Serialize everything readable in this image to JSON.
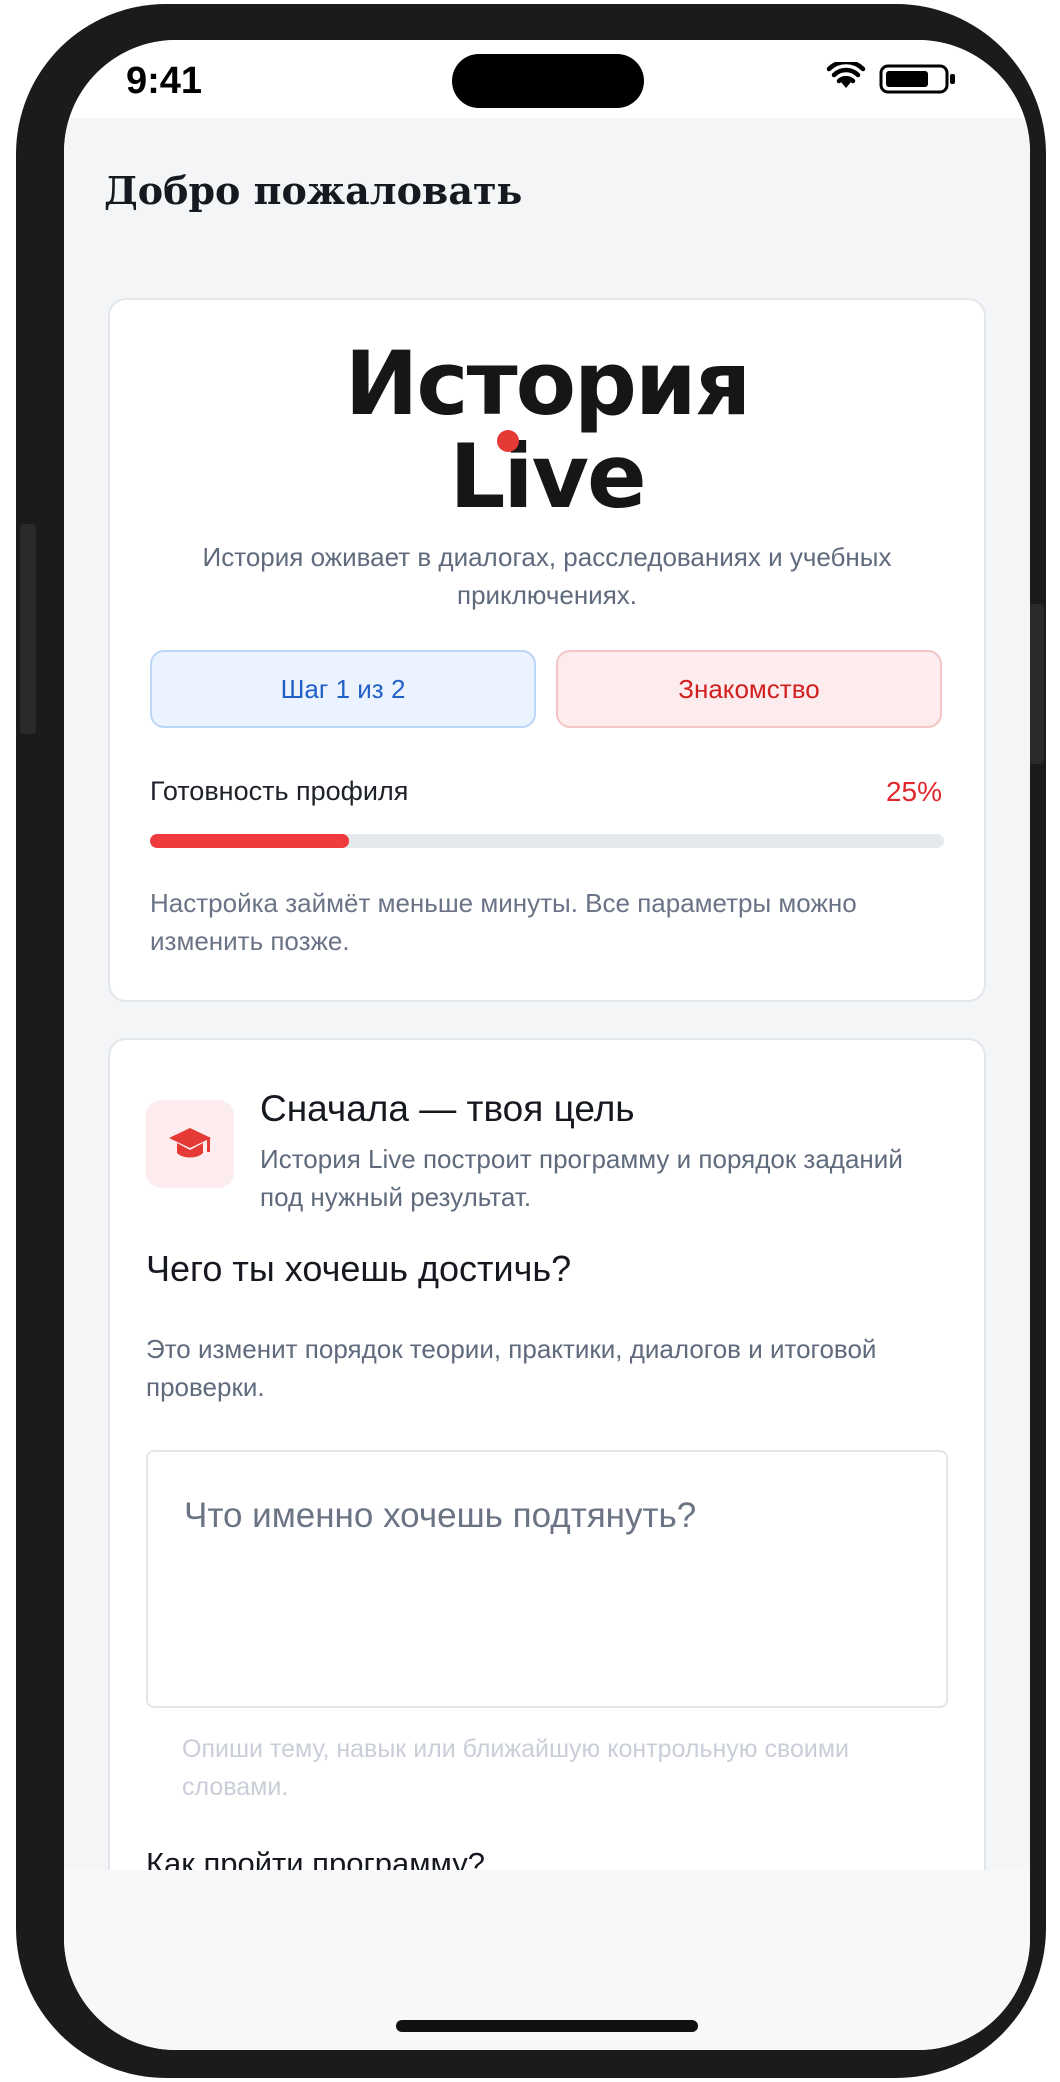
{
  "status_bar": {
    "time": "9:41",
    "wifi_icon": "wifi-icon",
    "battery_icon": "battery-icon"
  },
  "header": {
    "title": "Добро пожаловать"
  },
  "hero": {
    "logo_line1": "История",
    "logo_line2": "Live",
    "logo_accent_color": "#e53935",
    "tagline": "История оживает в диалогах, расследованиях и учебных приключениях.",
    "step_label": "Шаг 1 из 2",
    "stage_label": "Знакомство",
    "progress_label": "Готовность профиля",
    "progress_text": "25%",
    "progress_value": 0.25,
    "hint": "Настройка займёт меньше минуты. Все параметры можно изменить позже."
  },
  "goal": {
    "icon": "graduation-cap-icon",
    "title": "Сначала — твоя цель",
    "subtitle": "История Live построит программу и порядок заданий под нужный результат.",
    "question": "Чего ты хочешь достичь?",
    "question_hint": "Это изменит порядок теории, практики, диалогов и итоговой проверки.",
    "input_placeholder": "Что именно хочешь подтянуть?",
    "input_value": "",
    "input_helper": "Опиши тему, навык или ближайшую контрольную своими словами.",
    "next_question": "Как пройти программу?"
  },
  "colors": {
    "accent_red": "#ef3b3d",
    "accent_blue": "#2260c8",
    "background": "#f4f5f7"
  }
}
